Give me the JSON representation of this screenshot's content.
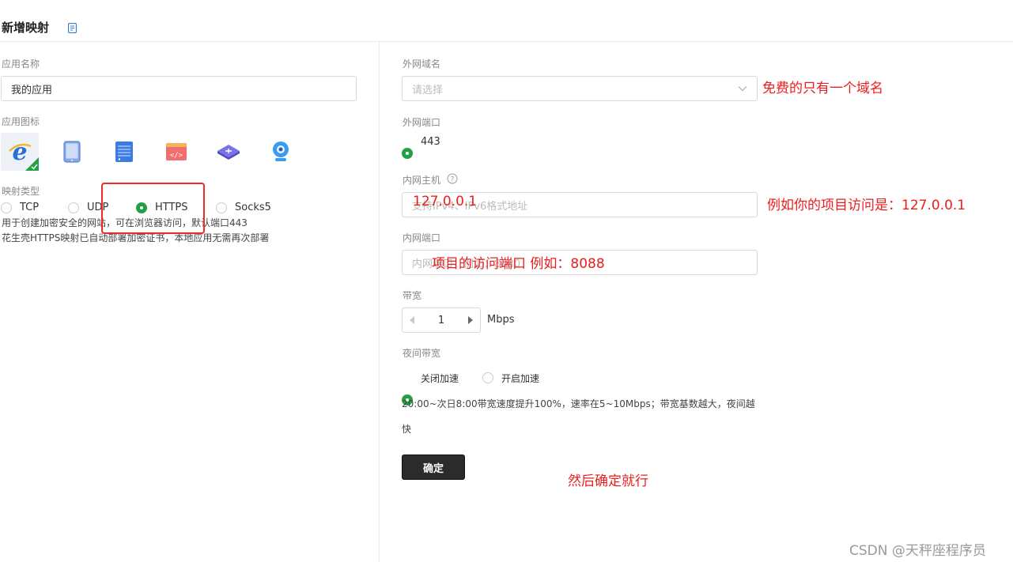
{
  "header": {
    "title": "新增映射",
    "icon": "doc-icon"
  },
  "left": {
    "app_name": {
      "label": "应用名称",
      "value": "我的应用"
    },
    "app_icon": {
      "label": "应用图标",
      "icons": [
        "ie-icon",
        "tablet-icon",
        "server-icon",
        "code-window-icon",
        "router-icon",
        "webcam-icon"
      ]
    },
    "mapping_type": {
      "label": "映射类型",
      "options": [
        "TCP",
        "UDP",
        "HTTPS",
        "Socks5"
      ],
      "selected": "HTTPS",
      "desc1": "用于创建加密安全的网站，可在浏览器访问，默认端口443",
      "desc2": "花生壳HTTPS映射已自动部署加密证书，本地应用无需再次部署"
    }
  },
  "right": {
    "domain": {
      "label": "外网域名",
      "placeholder": "请选择"
    },
    "ext_port": {
      "label": "外网端口",
      "value": "443"
    },
    "host": {
      "label": "内网主机",
      "placeholder": "支持IPv4、IPv6格式地址"
    },
    "int_port": {
      "label": "内网端口",
      "placeholder": "内网端口，例如：8080"
    },
    "bandwidth": {
      "label": "带宽",
      "value": "1",
      "unit": "Mbps"
    },
    "night": {
      "label": "夜间带宽",
      "option_off": "关闭加速",
      "option_on": "开启加速",
      "selected": "关闭加速",
      "desc_line1": "20:00~次日8:00带宽速度提升100%，速率在5~10Mbps；带宽基数越大，夜间越",
      "desc_line2": "快"
    },
    "confirm": "确定"
  },
  "annotations": {
    "domain_note": "免费的只有一个域名",
    "host_value": "127.0.0.1",
    "host_note": "例如你的项目访问是：127.0.0.1",
    "port_note": "项目的访问端口 例如：8088",
    "final_note": "然后确定就行"
  },
  "colors": {
    "accent": "#22a045",
    "annotation": "#ee1c1c",
    "button": "#2b2b2b"
  },
  "watermark": "CSDN @天秤座程序员"
}
